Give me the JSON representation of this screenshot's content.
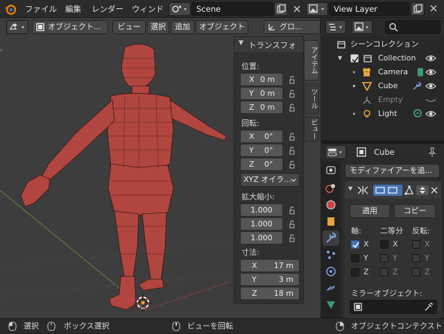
{
  "topbar": {
    "menus": [
      "ファイル",
      "編集",
      "レンダー",
      "ウィンド"
    ],
    "scene_value": "Scene",
    "viewlayer_value": "View Layer"
  },
  "viewport_header": {
    "mode_label": "オブジェクト...",
    "view_label": "ビュー",
    "select_label": "選択",
    "add_label": "追加",
    "object_label": "オブジェクト",
    "orientation_label": "グロ..."
  },
  "npanel": {
    "title": "トランスフォ",
    "location_label": "位置:",
    "location": [
      {
        "axis": "X",
        "value": "0 m"
      },
      {
        "axis": "Y",
        "value": "0 m"
      },
      {
        "axis": "Z",
        "value": "0 m"
      }
    ],
    "rotation_label": "回転:",
    "rotation": [
      {
        "axis": "X",
        "value": "0°"
      },
      {
        "axis": "Y",
        "value": "0°"
      },
      {
        "axis": "Z",
        "value": "0°"
      }
    ],
    "rotation_mode": "XYZ オイラ...",
    "scale_label": "拡大縮小:",
    "scale": [
      "1.000",
      "1.000",
      "1.000"
    ],
    "dimensions_label": "寸法:",
    "dimensions": [
      {
        "axis": "X",
        "value": "17 m"
      },
      {
        "axis": "Y",
        "value": "3 m"
      },
      {
        "axis": "Z",
        "value": "18 m"
      }
    ]
  },
  "side_tabs": {
    "item": "アイテム",
    "tool": "ツール",
    "view": "ビュー"
  },
  "outliner": {
    "title": "シーンコレクション",
    "collection": "Collection",
    "items": [
      {
        "name": "Camera",
        "icon": "camera-icon"
      },
      {
        "name": "Cube",
        "icon": "mesh-icon"
      },
      {
        "name": "Empty",
        "icon": "empty-icon"
      },
      {
        "name": "Light",
        "icon": "light-icon"
      }
    ]
  },
  "properties": {
    "object_name": "Cube",
    "add_modifier_label": "モディファイアーを追...",
    "apply_label": "適用",
    "copy_label": "コピー",
    "axis_label": "軸:",
    "bisect_label": "二等分",
    "flip_label": "反転:",
    "axes": [
      {
        "axis": "X",
        "axis_on": true,
        "bisect": "X",
        "flip": "X"
      },
      {
        "axis": "Y",
        "axis_on": false,
        "bisect": "Y",
        "flip": "Y"
      },
      {
        "axis": "Z",
        "axis_on": false,
        "bisect": "Z",
        "flip": "Z"
      }
    ],
    "mirror_object_label": "ミラーオブジェクト:"
  },
  "statusbar": {
    "select": "選択",
    "box_select": "ボックス選択",
    "rotate_view": "ビューを回転",
    "object_context": "オブジェクトコンテクスト"
  },
  "colors": {
    "accent": "#4772b3",
    "mesh": "#b0463f",
    "viewport": "#3d3d3d",
    "panel": "#303030"
  }
}
